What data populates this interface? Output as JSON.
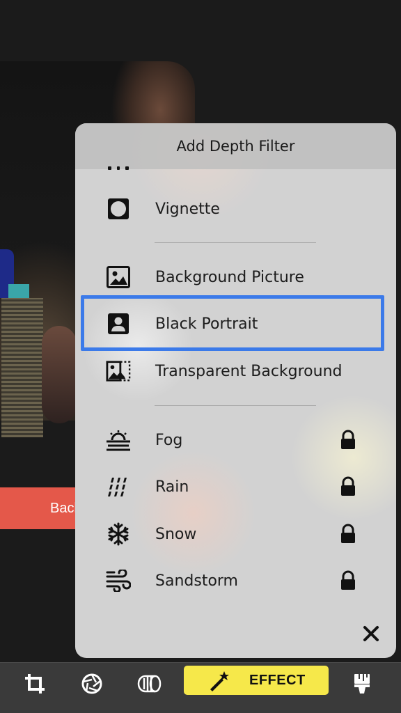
{
  "background": {
    "action_label": "Background"
  },
  "popover": {
    "title": "Add Depth Filter",
    "items": [
      {
        "label": "Vignette",
        "icon": "vignette-icon",
        "locked": false
      },
      {
        "label": "Background Picture",
        "icon": "picture-icon",
        "locked": false
      },
      {
        "label": "Black Portrait",
        "icon": "portrait-icon",
        "locked": false,
        "highlighted": true
      },
      {
        "label": "Transparent Background",
        "icon": "transparent-bg-icon",
        "locked": false
      },
      {
        "label": "Fog",
        "icon": "fog-icon",
        "locked": true
      },
      {
        "label": "Rain",
        "icon": "rain-icon",
        "locked": true
      },
      {
        "label": "Snow",
        "icon": "snow-icon",
        "locked": true
      },
      {
        "label": "Sandstorm",
        "icon": "sandstorm-icon",
        "locked": true
      }
    ],
    "close_icon": "close-icon",
    "highlight_color": "#3b7ae9"
  },
  "toolbar": {
    "crop_icon": "crop-icon",
    "aperture_icon": "aperture-icon",
    "lens_icon": "lens-icon",
    "effect_label": "EFFECT",
    "effect_icon": "magic-wand-icon",
    "brush_icon": "brush-icon",
    "effect_color": "#f6e84a"
  }
}
